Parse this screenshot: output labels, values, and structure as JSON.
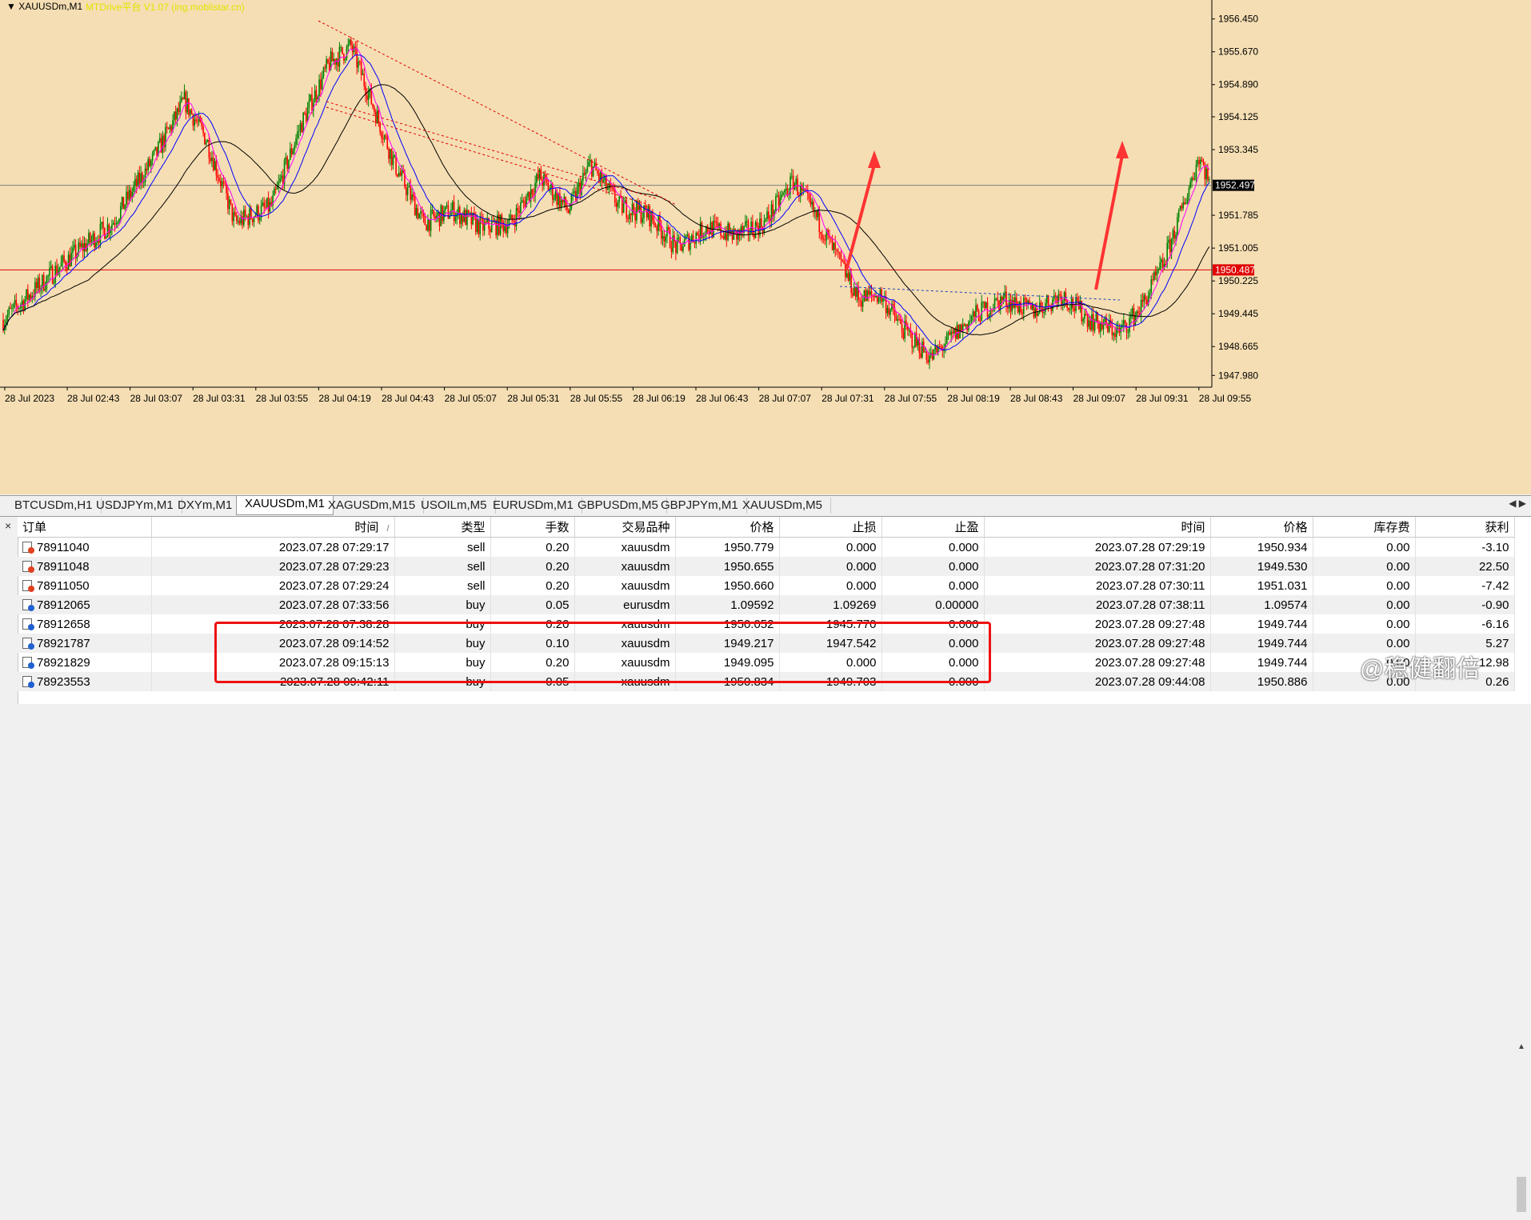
{
  "chart": {
    "symbol_title": "XAUUSDm,M1",
    "ea_label": "MTDrive平台 V1.07 (ing.moblistar.cn)",
    "price_labels": [
      "1956.450",
      "1955.670",
      "1954.890",
      "1954.125",
      "1953.345",
      "1952.497",
      "1951.785",
      "1951.005",
      "1950.487",
      "1950.225",
      "1949.445",
      "1948.665",
      "1947.980"
    ],
    "time_labels": [
      "28 Jul 2023",
      "28 Jul 02:43",
      "28 Jul 03:07",
      "28 Jul 03:31",
      "28 Jul 03:55",
      "28 Jul 04:19",
      "28 Jul 04:43",
      "28 Jul 05:07",
      "28 Jul 05:31",
      "28 Jul 05:55",
      "28 Jul 06:19",
      "28 Jul 06:43",
      "28 Jul 07:07",
      "28 Jul 07:31",
      "28 Jul 07:55",
      "28 Jul 08:19",
      "28 Jul 08:43",
      "28 Jul 09:07",
      "28 Jul 09:31",
      "28 Jul 09:55"
    ],
    "current_price": "1952.497",
    "stop_price": "1950.487",
    "colors": {
      "bg": "#f5deb3",
      "up": "#008000",
      "down": "#ff0000",
      "grid": "#000000",
      "ma_fast": "#ff00ff",
      "ma_mid": "#0000ff",
      "ma_slow": "#000000",
      "arrow": "#ff3333"
    }
  },
  "tabs": [
    "BTCUSDm,H1",
    "USDJPYm,M1",
    "DXYm,M1",
    "XAUUSDm,M1",
    "XAGUSDm,M15",
    "USOILm,M5",
    "EURUSDm,M1",
    "GBPUSDm,M5",
    "GBPJPYm,M1",
    "XAUUSDm,M5"
  ],
  "active_tab": 3,
  "terminal": {
    "close_glyph": "×",
    "columns": [
      "订单",
      "时间",
      "类型",
      "手数",
      "交易品种",
      "价格",
      "止损",
      "止盈",
      "时间",
      "价格",
      "库存费",
      "获利"
    ],
    "sort_indicator": "/",
    "rows": [
      {
        "order": "78911040",
        "open_time": "2023.07.28 07:29:17",
        "type": "sell",
        "lots": "0.20",
        "symbol": "xauusdm",
        "price": "1950.779",
        "sl": "0.000",
        "tp": "0.000",
        "close_time": "2023.07.28 07:29:19",
        "close_price": "1950.934",
        "swap": "0.00",
        "profit": "-3.10",
        "icon_color": "#e04020"
      },
      {
        "order": "78911048",
        "open_time": "2023.07.28 07:29:23",
        "type": "sell",
        "lots": "0.20",
        "symbol": "xauusdm",
        "price": "1950.655",
        "sl": "0.000",
        "tp": "0.000",
        "close_time": "2023.07.28 07:31:20",
        "close_price": "1949.530",
        "swap": "0.00",
        "profit": "22.50",
        "icon_color": "#e04020"
      },
      {
        "order": "78911050",
        "open_time": "2023.07.28 07:29:24",
        "type": "sell",
        "lots": "0.20",
        "symbol": "xauusdm",
        "price": "1950.660",
        "sl": "0.000",
        "tp": "0.000",
        "close_time": "2023.07.28 07:30:11",
        "close_price": "1951.031",
        "swap": "0.00",
        "profit": "-7.42",
        "icon_color": "#e04020"
      },
      {
        "order": "78912065",
        "open_time": "2023.07.28 07:33:56",
        "type": "buy",
        "lots": "0.05",
        "symbol": "eurusdm",
        "price": "1.09592",
        "sl": "1.09269",
        "tp": "0.00000",
        "close_time": "2023.07.28 07:38:11",
        "close_price": "1.09574",
        "swap": "0.00",
        "profit": "-0.90",
        "icon_color": "#2060d0"
      },
      {
        "order": "78912658",
        "open_time": "2023.07.28 07:38:28",
        "type": "buy",
        "lots": "0.20",
        "symbol": "xauusdm",
        "price": "1950.052",
        "sl": "1945.770",
        "tp": "0.000",
        "close_time": "2023.07.28 09:27:48",
        "close_price": "1949.744",
        "swap": "0.00",
        "profit": "-6.16",
        "icon_color": "#2060d0"
      },
      {
        "order": "78921787",
        "open_time": "2023.07.28 09:14:52",
        "type": "buy",
        "lots": "0.10",
        "symbol": "xauusdm",
        "price": "1949.217",
        "sl": "1947.542",
        "tp": "0.000",
        "close_time": "2023.07.28 09:27:48",
        "close_price": "1949.744",
        "swap": "0.00",
        "profit": "5.27",
        "icon_color": "#2060d0"
      },
      {
        "order": "78921829",
        "open_time": "2023.07.28 09:15:13",
        "type": "buy",
        "lots": "0.20",
        "symbol": "xauusdm",
        "price": "1949.095",
        "sl": "0.000",
        "tp": "0.000",
        "close_time": "2023.07.28 09:27:48",
        "close_price": "1949.744",
        "swap": "0.00",
        "profit": "12.98",
        "icon_color": "#2060d0"
      },
      {
        "order": "78923553",
        "open_time": "2023.07.28 09:42:11",
        "type": "buy",
        "lots": "0.05",
        "symbol": "xauusdm",
        "price": "1950.834",
        "sl": "1949.703",
        "tp": "0.000",
        "close_time": "2023.07.28 09:44:08",
        "close_price": "1950.886",
        "swap": "0.00",
        "profit": "0.26",
        "icon_color": "#2060d0"
      }
    ]
  },
  "watermark": "@稳健翻倍"
}
